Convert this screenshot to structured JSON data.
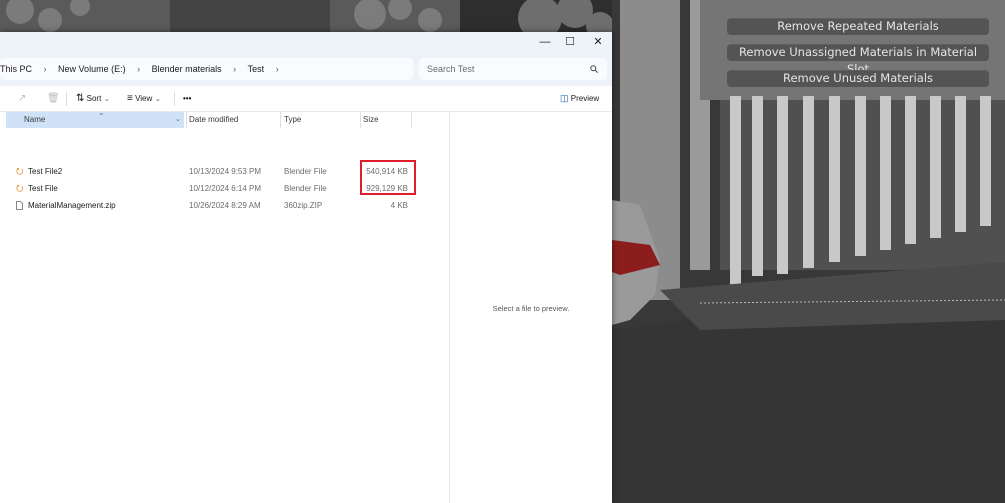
{
  "blender": {
    "buttons": [
      {
        "label": "Remove Repeated Materials"
      },
      {
        "label": "Remove Unassigned Materials in Material Slot"
      },
      {
        "label": "Remove Unused Materials"
      }
    ]
  },
  "explorer": {
    "window_controls": {
      "minimize": "—",
      "maximize": "☐",
      "close": "✕"
    },
    "breadcrumb": [
      "This PC",
      "New Volume (E:)",
      "Blender materials",
      "Test"
    ],
    "search": {
      "placeholder": "Search Test"
    },
    "toolbar": {
      "sort_label": "Sort",
      "view_label": "View",
      "more_label": "•••",
      "preview_label": "Preview"
    },
    "columns": {
      "name": "Name",
      "date": "Date modified",
      "type": "Type",
      "size": "Size"
    },
    "files": [
      {
        "name": "Test File2",
        "date": "10/13/2024 9:53 PM",
        "type": "Blender File",
        "size": "540,914 KB",
        "icon": "blender-file-icon"
      },
      {
        "name": "Test File",
        "date": "10/12/2024 6:14 PM",
        "type": "Blender File",
        "size": "929,129 KB",
        "icon": "blender-file-icon"
      },
      {
        "name": "MaterialManagement.zip",
        "date": "10/26/2024 8:29 AM",
        "type": "360zip.ZIP",
        "size": "4 KB",
        "icon": "zip-file-icon"
      }
    ],
    "preview_text": "Select a file to preview."
  },
  "colors": {
    "highlight": "#e01e2b",
    "selected_header": "#cfe2f7",
    "blender_button": "#545454"
  }
}
